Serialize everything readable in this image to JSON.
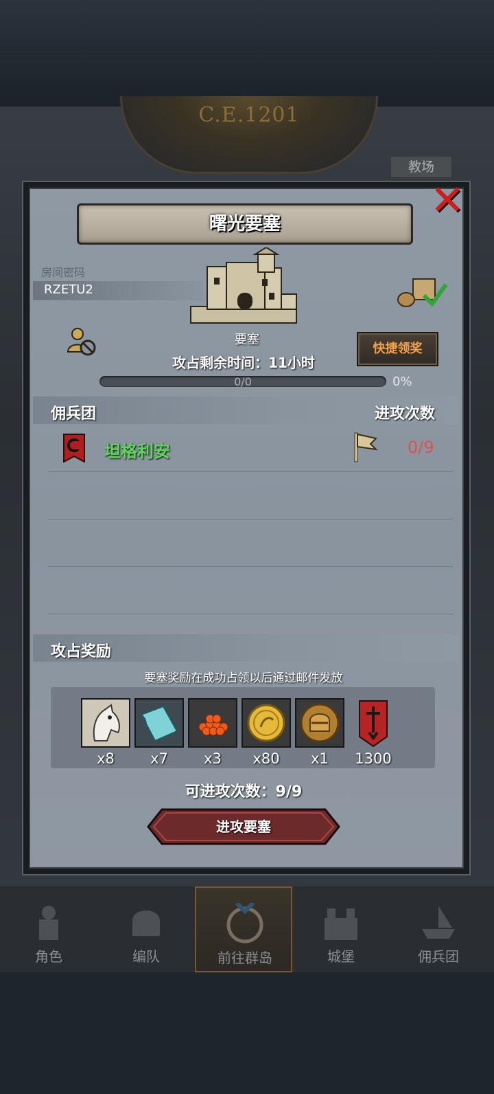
{
  "background": {
    "era": "C.E.1201",
    "side_tab": "教场"
  },
  "dialog": {
    "title": "曙光要塞",
    "room_password_label": "房间密码",
    "room_password": "RZETU2",
    "fortress_type": "要塞",
    "occupation_timer": "攻占剩余时间：11小时",
    "progress_text": "0/0",
    "progress_percent": "0%",
    "quick_claim_label": "快捷领奖",
    "mercenary_header": "佣兵团",
    "attack_count_header": "进攻次数",
    "mercenaries": [
      {
        "name": "坦格利安",
        "attacks": "0/9"
      }
    ],
    "rewards_header": "攻占奖励",
    "rewards_note": "要塞奖励在成功占领以后通过邮件发放",
    "rewards": [
      {
        "icon": "horse-icon",
        "qty": "x8"
      },
      {
        "icon": "cloth-icon",
        "qty": "x7"
      },
      {
        "icon": "red-beads-icon",
        "qty": "x3"
      },
      {
        "icon": "gold-coin-icon",
        "qty": "x80"
      },
      {
        "icon": "helmet-medal-icon",
        "qty": "x1"
      },
      {
        "icon": "red-banner-icon",
        "qty": "1300"
      }
    ],
    "attempts_text": "可进攻次数：9/9",
    "attack_button": "进攻要塞"
  },
  "nav": [
    {
      "label": "角色",
      "icon": "knight-icon"
    },
    {
      "label": "编队",
      "icon": "helmet-icon"
    },
    {
      "label": "前往群岛",
      "icon": "compass-icon",
      "active": true
    },
    {
      "label": "城堡",
      "icon": "castle-icon"
    },
    {
      "label": "佣兵团",
      "icon": "ship-icon"
    }
  ],
  "colors": {
    "mercenary_name": "#5ed65a",
    "attack_count": "#d9534f",
    "quick_claim_text": "#f2a24a",
    "close": "#d41b1b"
  }
}
